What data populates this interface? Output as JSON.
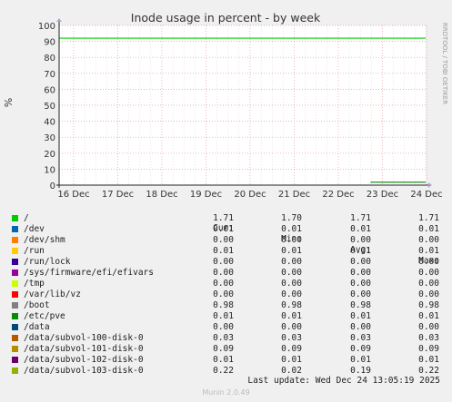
{
  "chart_data": {
    "type": "line",
    "title": "Inode usage in percent - by week",
    "ylabel": "%",
    "ylim": [
      0,
      100
    ],
    "yticks": [
      "0",
      "10",
      "20",
      "30",
      "40",
      "50",
      "60",
      "70",
      "80",
      "90",
      "100"
    ],
    "xticks": [
      "16 Dec",
      "17 Dec",
      "18 Dec",
      "19 Dec",
      "20 Dec",
      "21 Dec",
      "22 Dec",
      "23 Dec",
      "24 Dec"
    ],
    "x_range": [
      "16 Dec",
      "24 Dec"
    ],
    "grid": true,
    "side_label": "RRDTOOL / TOBI OETIKER",
    "lines": [
      {
        "color": "#00cc00",
        "from": "16 Dec",
        "to": "24 Dec",
        "y_start": 92,
        "y_end": 92
      },
      {
        "color": "#008000",
        "from": "23 Dec",
        "to": "24 Dec",
        "y_start": 1.8,
        "y_end": 1.8
      }
    ]
  },
  "legend_headers": {
    "cur": "Cur:",
    "min": "Min:",
    "avg": "Avg:",
    "max": "Max:"
  },
  "legend": [
    {
      "name": "/",
      "color": "#00cc00",
      "cur": "1.71",
      "min": "1.70",
      "avg": "1.71",
      "max": "1.71"
    },
    {
      "name": "/dev",
      "color": "#0066b3",
      "cur": "0.01",
      "min": "0.01",
      "avg": "0.01",
      "max": "0.01"
    },
    {
      "name": "/dev/shm",
      "color": "#ff8000",
      "cur": "0.00",
      "min": "0.00",
      "avg": "0.00",
      "max": "0.00"
    },
    {
      "name": "/run",
      "color": "#ffcc00",
      "cur": "0.01",
      "min": "0.01",
      "avg": "0.01",
      "max": "0.01"
    },
    {
      "name": "/run/lock",
      "color": "#330099",
      "cur": "0.00",
      "min": "0.00",
      "avg": "0.00",
      "max": "0.00"
    },
    {
      "name": "/sys/firmware/efi/efivars",
      "color": "#990099",
      "cur": "0.00",
      "min": "0.00",
      "avg": "0.00",
      "max": "0.00"
    },
    {
      "name": "/tmp",
      "color": "#ccff00",
      "cur": "0.00",
      "min": "0.00",
      "avg": "0.00",
      "max": "0.00"
    },
    {
      "name": "/var/lib/vz",
      "color": "#ff0000",
      "cur": "0.00",
      "min": "0.00",
      "avg": "0.00",
      "max": "0.00"
    },
    {
      "name": "/boot",
      "color": "#808080",
      "cur": "0.98",
      "min": "0.98",
      "avg": "0.98",
      "max": "0.98"
    },
    {
      "name": "/etc/pve",
      "color": "#008f00",
      "cur": "0.01",
      "min": "0.01",
      "avg": "0.01",
      "max": "0.01"
    },
    {
      "name": "/data",
      "color": "#00487d",
      "cur": "0.00",
      "min": "0.00",
      "avg": "0.00",
      "max": "0.00"
    },
    {
      "name": "/data/subvol-100-disk-0",
      "color": "#b35a00",
      "cur": "0.03",
      "min": "0.03",
      "avg": "0.03",
      "max": "0.03"
    },
    {
      "name": "/data/subvol-101-disk-0",
      "color": "#b38f00",
      "cur": "0.09",
      "min": "0.09",
      "avg": "0.09",
      "max": "0.09"
    },
    {
      "name": "/data/subvol-102-disk-0",
      "color": "#6b006b",
      "cur": "0.01",
      "min": "0.01",
      "avg": "0.01",
      "max": "0.01"
    },
    {
      "name": "/data/subvol-103-disk-0",
      "color": "#8fb300",
      "cur": "0.22",
      "min": "0.02",
      "avg": "0.19",
      "max": "0.22"
    }
  ],
  "last_update": "Last update: Wed Dec 24 13:05:19 2025",
  "footer": "Munin 2.0.49"
}
